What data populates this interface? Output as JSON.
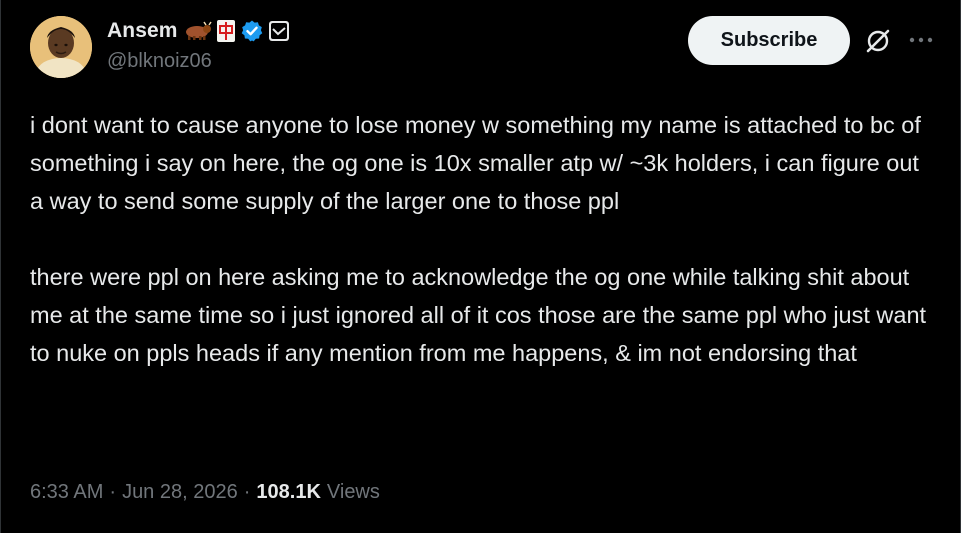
{
  "author": {
    "display_name": "Ansem",
    "handle": "@blknoiz06",
    "badges": [
      "ox-emoji",
      "mahjong-red-dragon-emoji",
      "verified-badge-icon",
      "affiliate-badge-icon"
    ]
  },
  "actions": {
    "subscribe_label": "Subscribe",
    "grok_icon": "grok-icon",
    "more_icon": "more-icon"
  },
  "tweet": {
    "paragraphs": [
      "i dont want to cause anyone to lose money w something my name is attached to bc of something i say on here, the og one is 10x smaller atp w/ ~3k holders, i can figure out a way to send some supply of the larger one to those ppl",
      "there were ppl on here asking me to acknowledge the og one while talking shit about me at the same time so i just ignored all of it cos those are the same ppl who just want to nuke on ppls heads if any mention from me happens, & im not endorsing that"
    ]
  },
  "meta": {
    "time": "6:33 AM",
    "separator": "·",
    "date": "Jun 28, 2026",
    "views_count": "108.1K",
    "views_label": "Views"
  },
  "colors": {
    "background": "#000000",
    "primary_text": "#e7e9ea",
    "secondary_text": "#71767b",
    "verified_blue": "#1d9bf0",
    "button_bg": "#eff3f4"
  }
}
